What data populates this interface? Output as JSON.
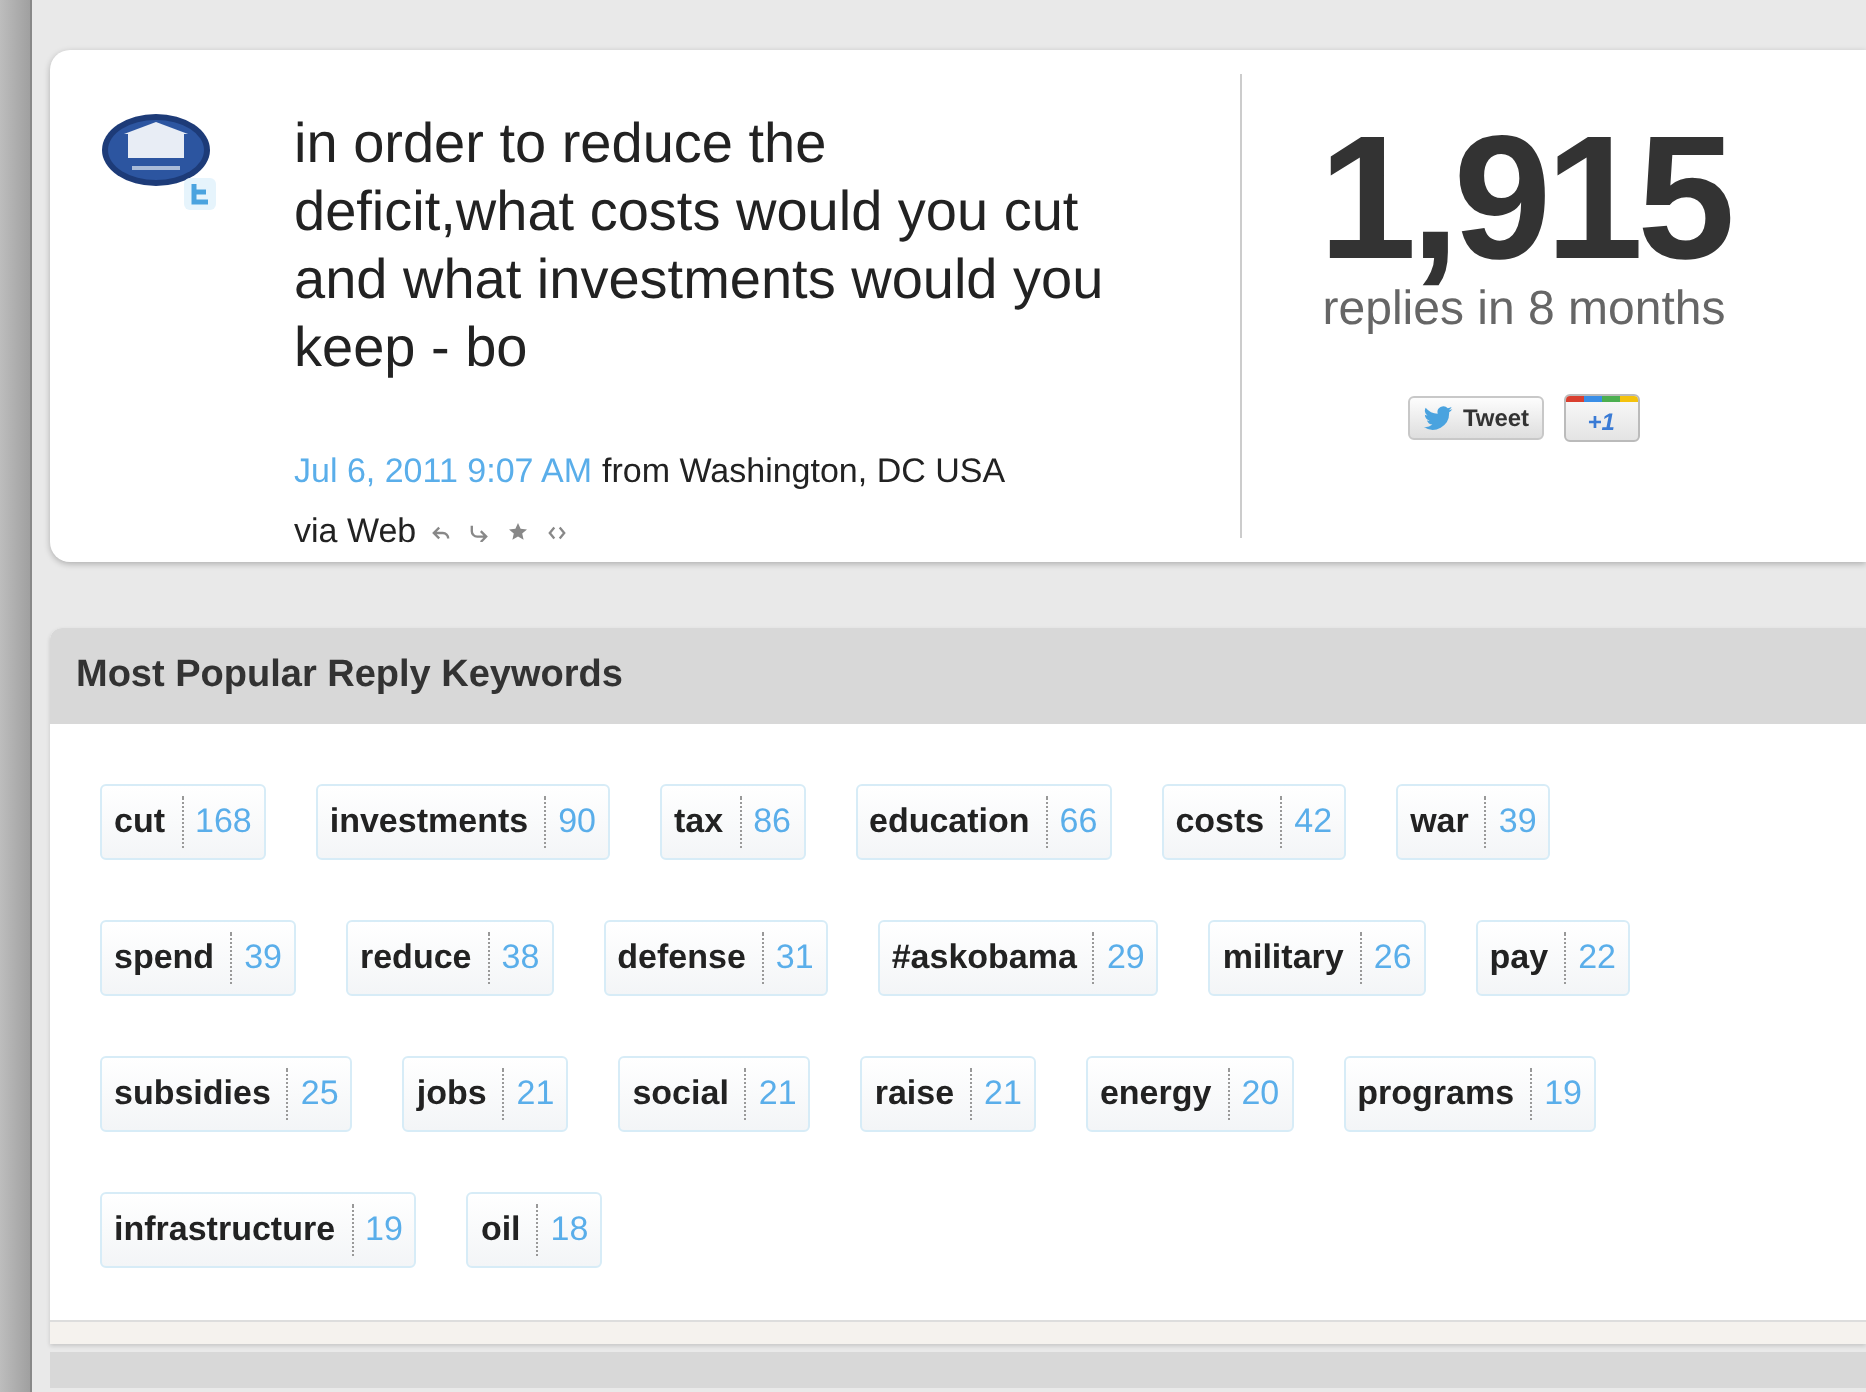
{
  "tweet": {
    "text": "in order to reduce the deficit,what costs would you cut and what investments would you keep - bo",
    "timestamp": "Jul 6, 2011 9:07 AM",
    "location": "from Washington, DC USA",
    "via": "via Web"
  },
  "stats": {
    "count": "1,915",
    "caption": "replies in 8 months",
    "buttons": [
      {
        "kind": "tweet",
        "label": "Tweet"
      },
      {
        "kind": "plusone",
        "label": "+1"
      }
    ]
  },
  "keywords_panel": {
    "title": "Most Popular Reply Keywords",
    "rows": [
      [
        {
          "word": "cut",
          "count": "168"
        },
        {
          "word": "investments",
          "count": "90"
        },
        {
          "word": "tax",
          "count": "86"
        },
        {
          "word": "education",
          "count": "66"
        },
        {
          "word": "costs",
          "count": "42"
        },
        {
          "word": "war",
          "count": "39"
        }
      ],
      [
        {
          "word": "spend",
          "count": "39"
        },
        {
          "word": "reduce",
          "count": "38"
        },
        {
          "word": "defense",
          "count": "31"
        },
        {
          "word": "#askobama",
          "count": "29"
        },
        {
          "word": "military",
          "count": "26"
        },
        {
          "word": "pay",
          "count": "22"
        }
      ],
      [
        {
          "word": "subsidies",
          "count": "25"
        },
        {
          "word": "jobs",
          "count": "21"
        },
        {
          "word": "social",
          "count": "21"
        },
        {
          "word": "raise",
          "count": "21"
        },
        {
          "word": "energy",
          "count": "20"
        },
        {
          "word": "programs",
          "count": "19"
        }
      ],
      [
        {
          "word": "infrastructure",
          "count": "19"
        },
        {
          "word": "oil",
          "count": "18"
        }
      ]
    ]
  }
}
